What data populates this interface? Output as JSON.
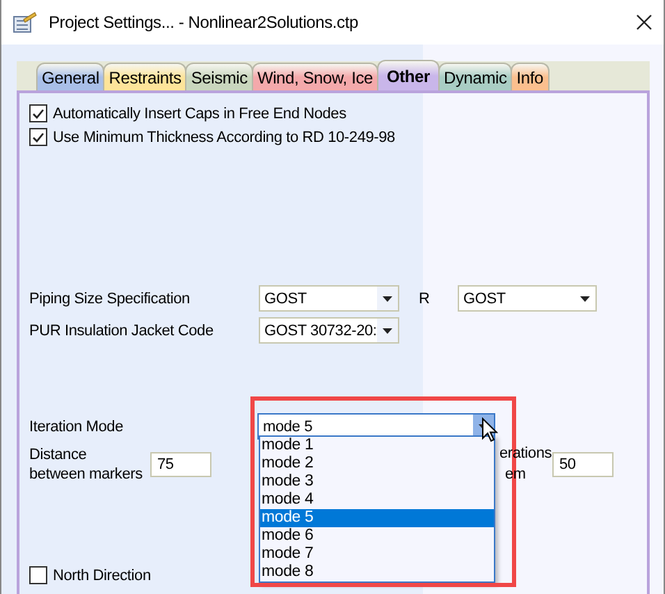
{
  "window": {
    "title": "Project Settings... - Nonlinear2Solutions.ctp"
  },
  "tabs": [
    {
      "label": "General",
      "color": "#a9bfe8",
      "selected": false
    },
    {
      "label": "Restraints",
      "color": "#fde49a",
      "selected": false
    },
    {
      "label": "Seismic",
      "color": "#c9d6bd",
      "selected": false
    },
    {
      "label": "Wind, Snow, Ice",
      "color": "#f4a9ab",
      "selected": false
    },
    {
      "label": "Other",
      "color": "#c9b6ea",
      "selected": true
    },
    {
      "label": "Dynamic",
      "color": "#a9cdc4",
      "selected": false
    },
    {
      "label": "Info",
      "color": "#fbbf8e",
      "selected": false
    }
  ],
  "options": [
    {
      "label": "Automatically Insert Caps in Free End Nodes",
      "checked": true
    },
    {
      "label": "Use Minimum Thickness According to RD 10-249-98",
      "checked": true
    }
  ],
  "piping_size_specification": {
    "label": "Piping Size Specification",
    "value": "GOST",
    "r_label": "R",
    "r_value": "GOST"
  },
  "pur_insulation_jacket_code": {
    "label": "PUR Insulation Jacket Code",
    "value": "GOST 30732-20:"
  },
  "iteration_mode": {
    "label": "Iteration Mode",
    "value": "mode 5",
    "expanded": true,
    "options": [
      {
        "label": "mode 1",
        "selected": false
      },
      {
        "label": "mode 2",
        "selected": false
      },
      {
        "label": "mode 3",
        "selected": false
      },
      {
        "label": "mode 4",
        "selected": false
      },
      {
        "label": "mode 5",
        "selected": true
      },
      {
        "label": "mode 6",
        "selected": false
      },
      {
        "label": "mode 7",
        "selected": false
      },
      {
        "label": "mode 8",
        "selected": false
      }
    ]
  },
  "distance_between_markers": {
    "label": "Distance\nbetween markers",
    "value": "75"
  },
  "iterations_field": {
    "label_lines": [
      "erations",
      "em"
    ],
    "value": "50"
  },
  "north_direction": {
    "label": "North Direction",
    "checked": false
  }
}
